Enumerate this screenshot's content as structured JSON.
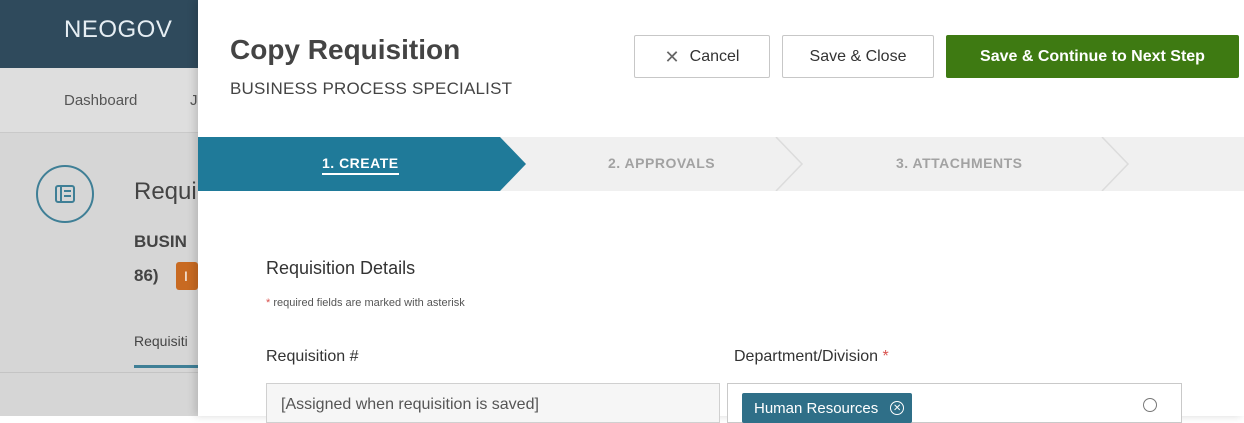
{
  "app": {
    "logo": "NEOGOV"
  },
  "background": {
    "nav_items": [
      "Dashboard",
      "J"
    ],
    "record_title_fragment": "Requi",
    "record_subtitle_fragment": "BUSIN",
    "record_id_fragment": "86)",
    "badge_fragment": "I",
    "tab_fragment": "Requisiti",
    "icon": "document-icon"
  },
  "modal": {
    "title": "Copy Requisition",
    "subtitle": "BUSINESS PROCESS SPECIALIST",
    "buttons": {
      "cancel": "Cancel",
      "cancel_icon": "close-icon",
      "save_close": "Save & Close",
      "save_continue": "Save & Continue to Next Step"
    },
    "steps": [
      {
        "label": "1. CREATE",
        "active": true
      },
      {
        "label": "2. APPROVALS",
        "active": false
      },
      {
        "label": "3. ATTACHMENTS",
        "active": false
      }
    ],
    "form": {
      "section_title": "Requisition Details",
      "required_note_asterisk": "*",
      "required_note": "required fields are marked with asterisk",
      "requisition_number_label": "Requisition #",
      "requisition_number_value": "[Assigned when requisition is saved]",
      "department_label": "Department/Division",
      "department_required": "*",
      "department_selected": "Human Resources"
    }
  },
  "colors": {
    "topbar": "#2f4a5c",
    "step_active": "#1f7a99",
    "primary_button": "#3e7a12",
    "chip": "#2f6f88",
    "badge": "#c86a22"
  }
}
